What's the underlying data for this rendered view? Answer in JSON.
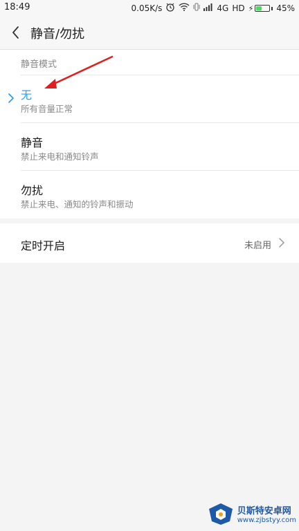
{
  "status_bar": {
    "time": "18:49",
    "net_speed": "0.05K/s",
    "network": "4G",
    "hd": "HD",
    "battery": "45%",
    "battery_level": 0.45
  },
  "header": {
    "title": "静音/勿扰"
  },
  "modes": {
    "section_label": "静音模式",
    "items": [
      {
        "title": "无",
        "subtitle": "所有音量正常",
        "selected": true
      },
      {
        "title": "静音",
        "subtitle": "禁止来电和通知铃声",
        "selected": false
      },
      {
        "title": "勿扰",
        "subtitle": "禁止来电、通知的铃声和振动",
        "selected": false
      }
    ]
  },
  "timer": {
    "label": "定时开启",
    "value": "未启用"
  },
  "watermark": {
    "title": "贝斯特安卓网",
    "url": "www.zjbstyy.com"
  },
  "colors": {
    "accent": "#2b9ef2",
    "arrow": "#e02020",
    "background": "#f4f4f4"
  }
}
